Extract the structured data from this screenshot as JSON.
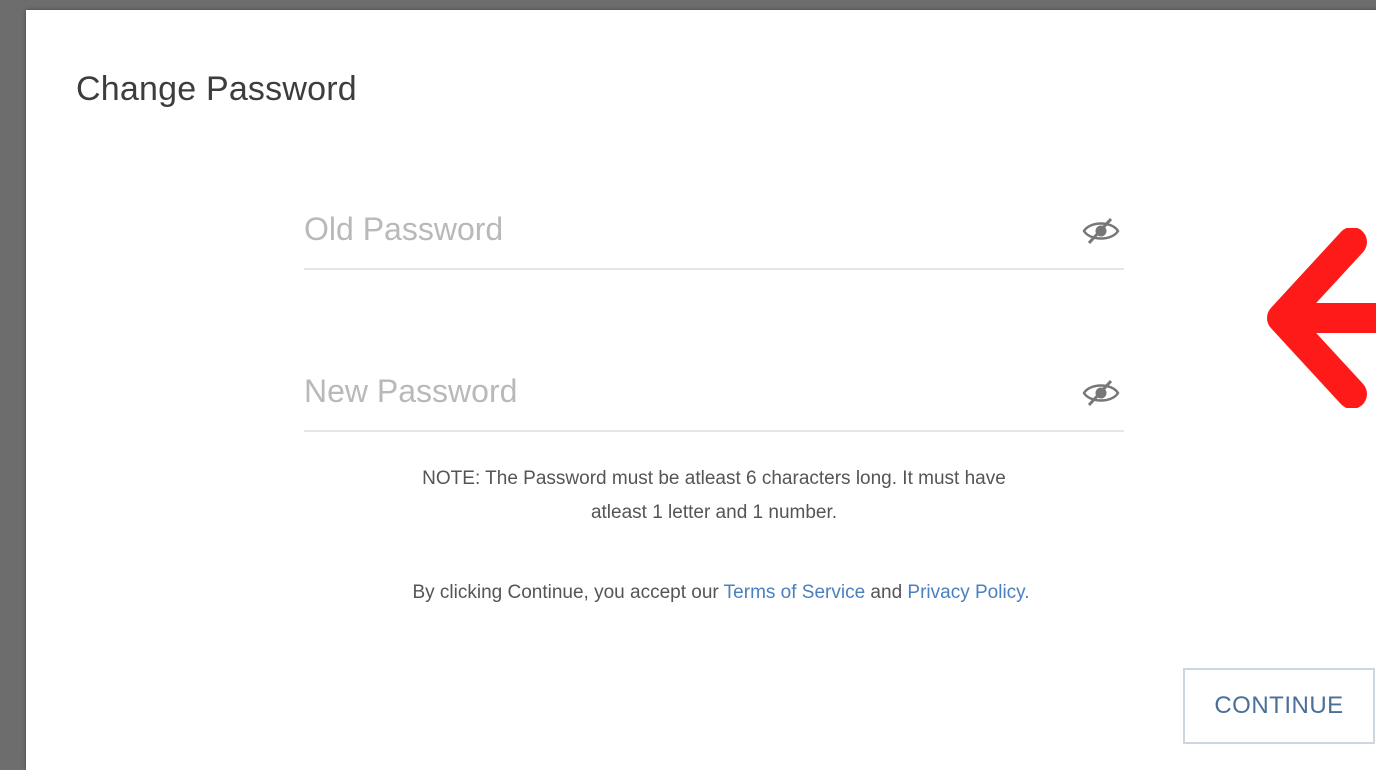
{
  "dialog": {
    "title": "Change Password"
  },
  "fields": {
    "old_password": {
      "value": "",
      "placeholder": "Old Password"
    },
    "new_password": {
      "value": "",
      "placeholder": "New Password"
    },
    "toggle_icon": "eye-slash-icon"
  },
  "note": {
    "line1": "NOTE: The Password must be atleast 6 characters long. It must have",
    "line2": "atleast 1 letter and 1 number."
  },
  "terms": {
    "prefix": "By clicking Continue, you accept our ",
    "terms_link": "Terms of Service",
    "middle": " and ",
    "privacy_link": "Privacy Policy."
  },
  "actions": {
    "continue_label": "CONTINUE"
  },
  "annotation": {
    "icon": "arrow-left-icon",
    "color": "#ff1a1a"
  },
  "colors": {
    "link": "#4a7fc0",
    "button_text": "#4a6f99",
    "backdrop": "#6d6d6d"
  }
}
